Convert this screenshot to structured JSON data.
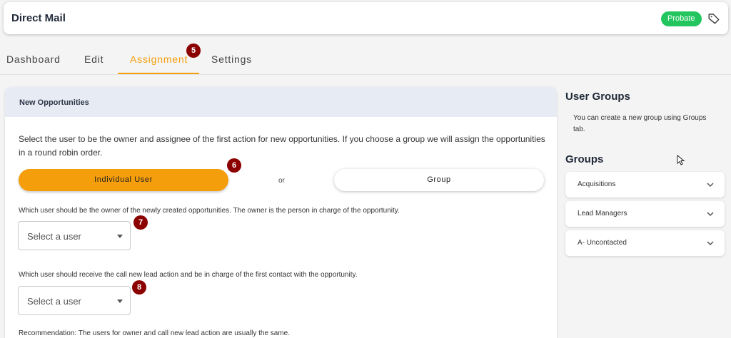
{
  "header": {
    "title": "Direct Mail",
    "badge": "Probate",
    "tag_icon": "tag-icon"
  },
  "tabs": [
    {
      "label": "Dashboard",
      "active": false
    },
    {
      "label": "Edit",
      "active": false
    },
    {
      "label": "Assignment",
      "active": true
    },
    {
      "label": "Settings",
      "active": false
    }
  ],
  "markers": [
    "5",
    "6",
    "7",
    "8"
  ],
  "card": {
    "title": "New Opportunities",
    "description": "Select the user to be the owner and assignee of the first action for new opportunities. If you choose a group we will assign the opportunities in a round robin order.",
    "individual_label": "Individual User",
    "or_label": "or",
    "group_label": "Group",
    "owner_question": "Which user should be the owner of the newly created opportunities. The owner is the person in charge of the opportunity.",
    "owner_select": "Select a user",
    "call_question": "Which user should receive the call new lead action and be in charge of the first contact with the opportunity.",
    "call_select": "Select a user",
    "recommendation": "Recommendation: The users for owner and call new lead action are usually the same."
  },
  "sidebar": {
    "user_groups_title": "User Groups",
    "user_groups_text": "You can create a new group using Groups tab.",
    "groups_title": "Groups",
    "groups": [
      {
        "label": "Acquisitions"
      },
      {
        "label": "Lead Managers"
      },
      {
        "label": "A- Uncontacted"
      }
    ]
  },
  "colors": {
    "accent": "#f59e0b",
    "badge": "#22c55e",
    "marker": "#8b0000",
    "card_header": "#e7ebf3"
  }
}
